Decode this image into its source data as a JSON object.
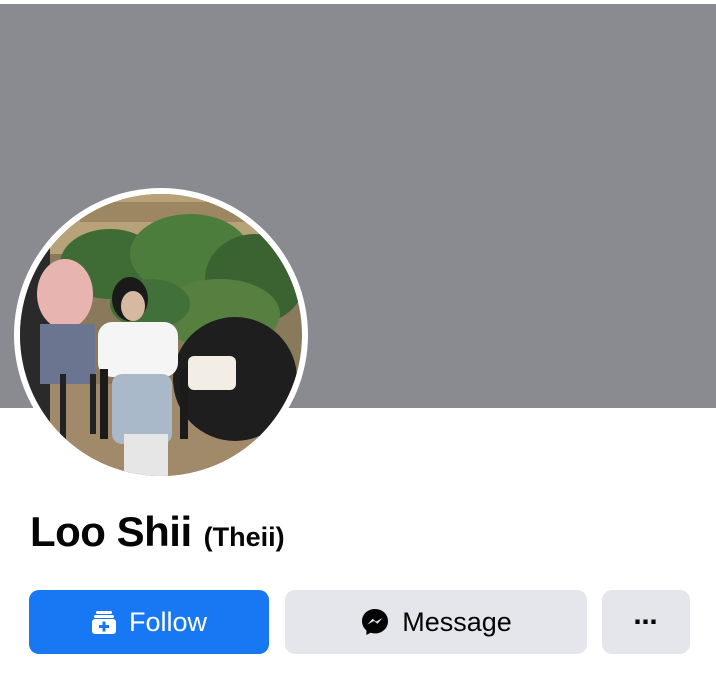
{
  "profile": {
    "name": "Loo Shii",
    "alternate_name": "(Theii)"
  },
  "actions": {
    "follow_label": "Follow",
    "message_label": "Message",
    "more_label": "⋯"
  },
  "icons": {
    "follow": "follow-add-icon",
    "message": "messenger-icon",
    "more": "more-dots-icon"
  },
  "colors": {
    "cover": "#898b90",
    "follow_button": "#1877f2",
    "secondary_button": "#e4e6eb",
    "text": "#050505"
  }
}
